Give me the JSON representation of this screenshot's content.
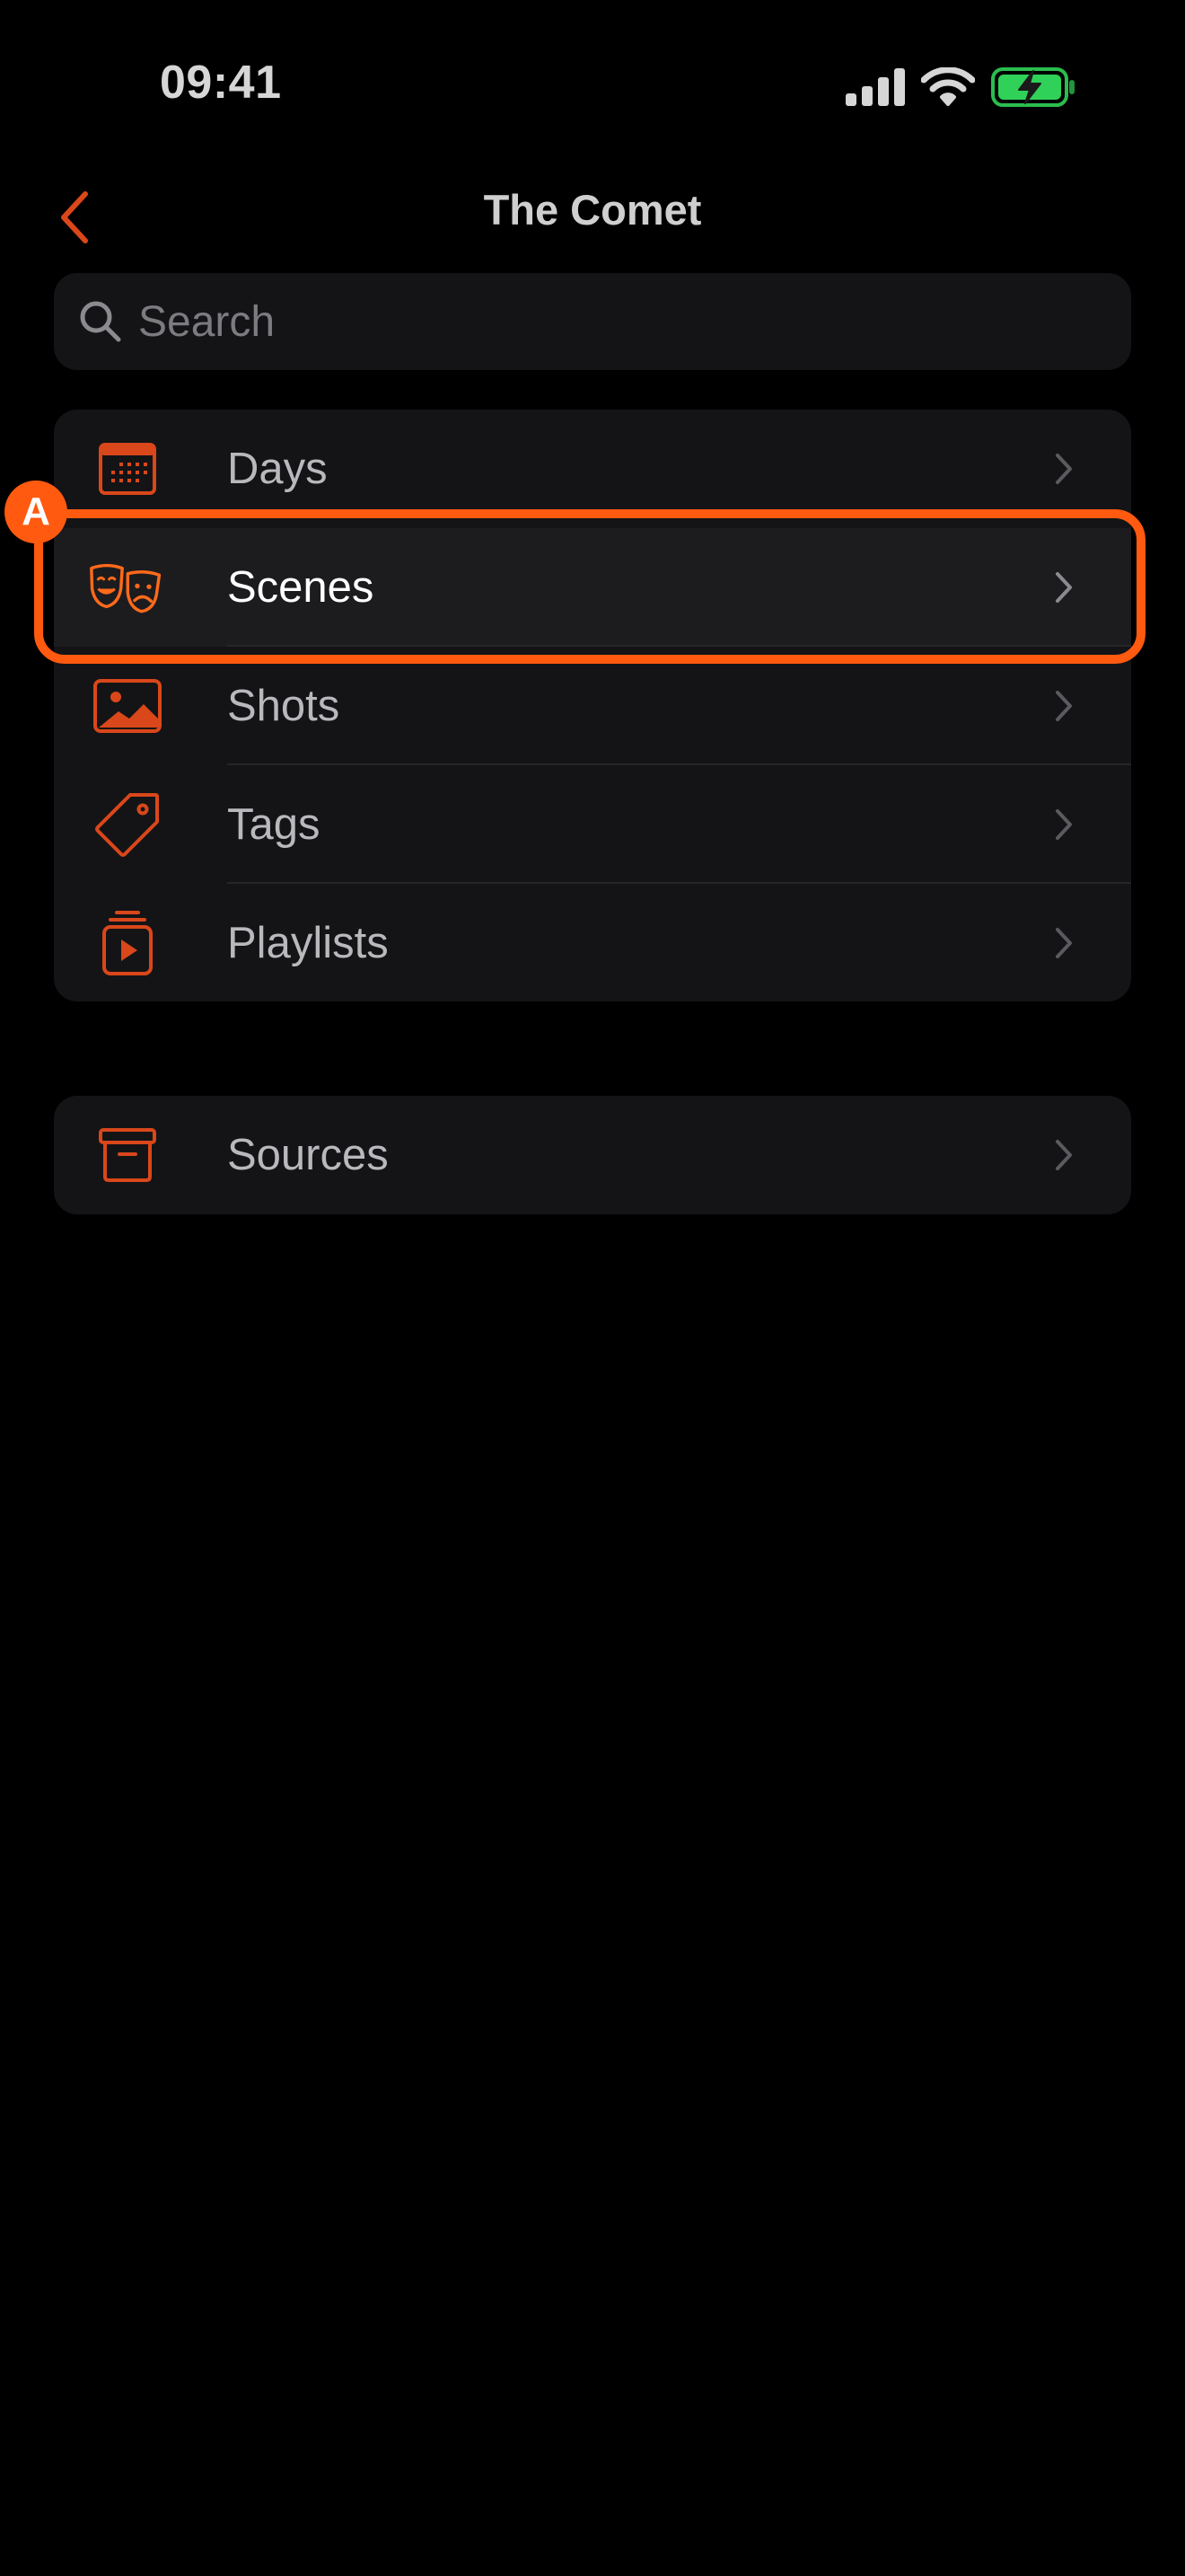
{
  "status_bar": {
    "time": "09:41",
    "icons": [
      "cellular-signal-icon",
      "wifi-icon",
      "battery-charging-icon"
    ],
    "battery_color": "#30d158"
  },
  "nav": {
    "title": "The Comet",
    "back_icon": "chevron-left-icon"
  },
  "search": {
    "placeholder": "Search",
    "icon": "magnifying-glass-icon"
  },
  "menu": {
    "items": [
      {
        "label": "Days",
        "icon": "calendar-icon"
      },
      {
        "label": "Scenes",
        "icon": "theater-masks-icon",
        "selected": true
      },
      {
        "label": "Shots",
        "icon": "photo-icon"
      },
      {
        "label": "Tags",
        "icon": "tag-icon"
      },
      {
        "label": "Playlists",
        "icon": "playlist-icon"
      }
    ]
  },
  "sources": {
    "items": [
      {
        "label": "Sources",
        "icon": "archive-box-icon"
      }
    ]
  },
  "annotation": {
    "marker": "A",
    "color": "#ff5a0f"
  },
  "colors": {
    "accent": "#d9471a",
    "background": "#000000",
    "group_background": "#141416"
  }
}
